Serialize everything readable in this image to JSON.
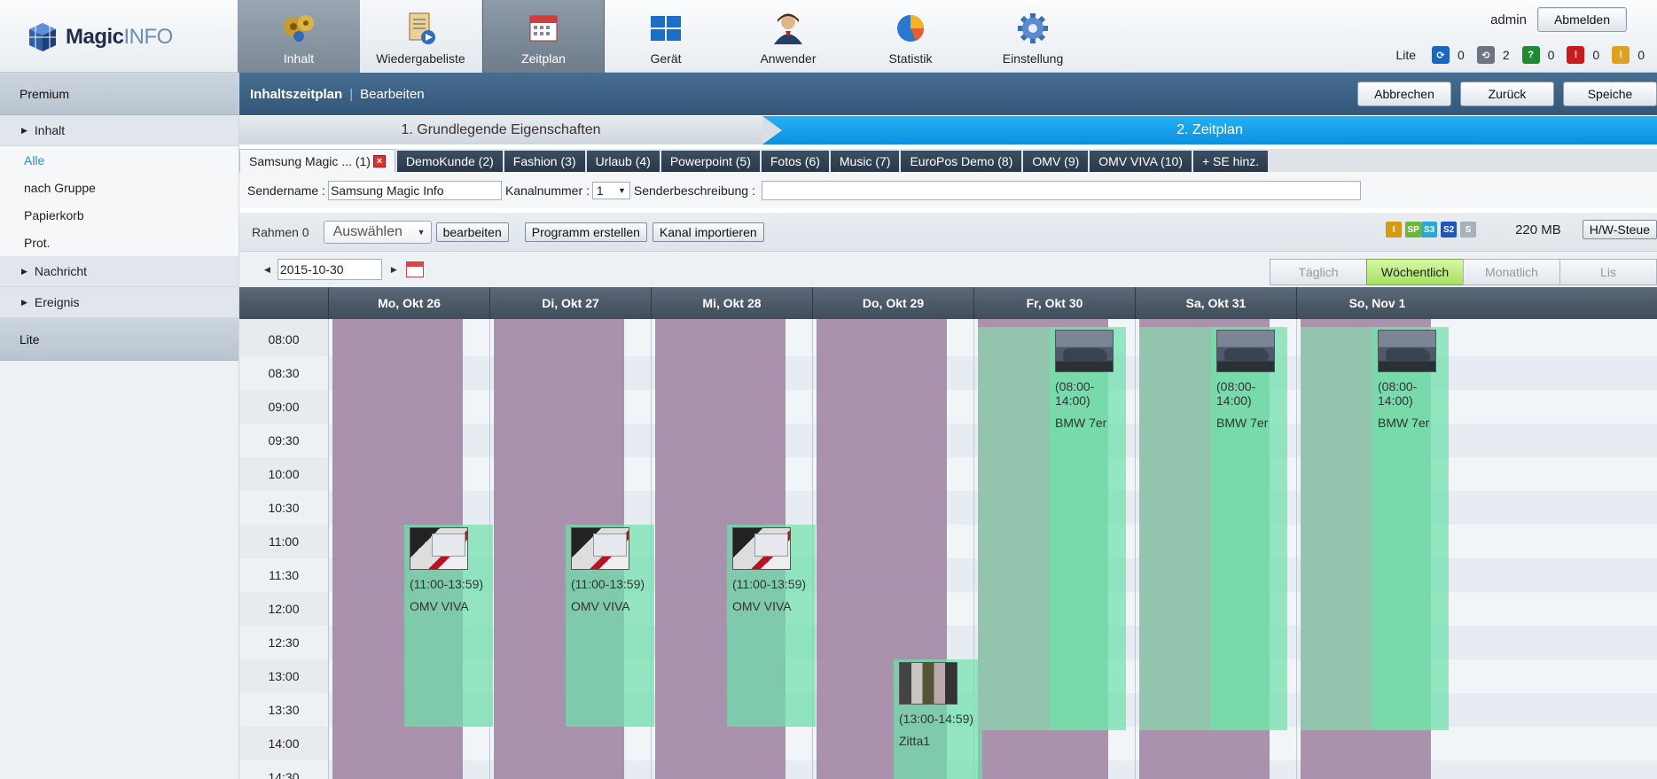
{
  "app": {
    "logo_bold": "Magic",
    "logo_light": "INFO"
  },
  "nav": [
    {
      "label": "Inhalt",
      "icon": "film-reel-icon"
    },
    {
      "label": "Wiedergabeliste",
      "icon": "playlist-icon"
    },
    {
      "label": "Zeitplan",
      "icon": "calendar-icon"
    },
    {
      "label": "Gerät",
      "icon": "device-icon"
    },
    {
      "label": "Anwender",
      "icon": "user-icon"
    },
    {
      "label": "Statistik",
      "icon": "pie-chart-icon"
    },
    {
      "label": "Einstellung",
      "icon": "gear-icon"
    }
  ],
  "user": {
    "name": "admin",
    "logout_label": "Abmelden"
  },
  "status": {
    "label": "Lite",
    "items": [
      {
        "icon": "connected-icon",
        "color": "#1a66c4",
        "count": "0"
      },
      {
        "icon": "disconnected-icon",
        "color": "#6c7580",
        "count": "2"
      },
      {
        "icon": "question-icon",
        "color": "#1f8a2f",
        "count": "0"
      },
      {
        "icon": "error-icon",
        "color": "#c81c1c",
        "count": "0"
      },
      {
        "icon": "warning-icon",
        "color": "#e0a020",
        "count": "0"
      }
    ]
  },
  "sidebar": {
    "premium": "Premium",
    "groups": [
      {
        "label": "Inhalt",
        "items": [
          "Alle",
          "nach Gruppe",
          "Papierkorb",
          "Prot."
        ]
      },
      {
        "label": "Nachricht",
        "items": []
      },
      {
        "label": "Ereignis",
        "items": []
      }
    ],
    "lite": "Lite"
  },
  "header": {
    "title": "Inhaltszeitplan",
    "subtitle": "Bearbeiten",
    "actions": [
      "Abbrechen",
      "Zurück",
      "Speiche"
    ]
  },
  "steps": {
    "step1": "1. Grundlegende Eigenschaften",
    "step2": "2. Zeitplan"
  },
  "channels": [
    "Samsung Magic ... (1)",
    "DemoKunde (2)",
    "Fashion (3)",
    "Urlaub (4)",
    "Powerpoint (5)",
    "Fotos (6)",
    "Music (7)",
    "EuroPos Demo (8)",
    "OMV (9)",
    "OMV VIVA (10)",
    "+ SE hinz."
  ],
  "channel_form": {
    "sendername_label": "Sendername :",
    "sendername_value": "Samsung Magic Info",
    "kanalnummer_label": "Kanalnummer :",
    "kanalnummer_value": "1",
    "beschreibung_label": "Senderbeschreibung :",
    "beschreibung_value": ""
  },
  "toolbar": {
    "frame_label": "Rahmen 0",
    "select_label": "Auswählen",
    "edit_label": "bearbeiten",
    "create_program_label": "Programm erstellen",
    "import_channel_label": "Kanal importieren",
    "badges": [
      {
        "text": "I",
        "color": "#d79a12"
      },
      {
        "text": "SP",
        "color": "#6cb93a"
      },
      {
        "text": "S3",
        "color": "#2aa7d8"
      },
      {
        "text": "S2",
        "color": "#2255c0"
      },
      {
        "text": "S",
        "color": "#a9b0b8"
      }
    ],
    "memory": "220 MB",
    "hw_label": "H/W-Steue"
  },
  "datebar": {
    "date": "2015-10-30",
    "views": [
      "Täglich",
      "Wöchentlich",
      "Monatlich",
      "Lis"
    ]
  },
  "schedule": {
    "days": [
      "Mo, Okt 26",
      "Di, Okt 27",
      "Mi, Okt 28",
      "Do, Okt 29",
      "Fr, Okt 30",
      "Sa, Okt 31",
      "So, Nov 1"
    ],
    "times": [
      "08:00",
      "08:30",
      "09:00",
      "09:30",
      "10:00",
      "10:30",
      "11:00",
      "11:30",
      "12:00",
      "12:30",
      "13:00",
      "13:30",
      "14:00",
      "14:30"
    ],
    "events": [
      {
        "day": 0,
        "time": "(11:00-13:59)",
        "title": "OMV VIVA",
        "thumb": "omv"
      },
      {
        "day": 1,
        "time": "(11:00-13:59)",
        "title": "OMV VIVA",
        "thumb": "omv"
      },
      {
        "day": 2,
        "time": "(11:00-13:59)",
        "title": "OMV VIVA",
        "thumb": "omv"
      },
      {
        "day": 3,
        "time": "(13:00-14:59)",
        "title": "Zitta1",
        "thumb": "zitta"
      },
      {
        "day": 4,
        "time": "(08:00-14:00)",
        "title": "BMW 7er",
        "thumb": "car"
      },
      {
        "day": 5,
        "time": "(08:00-14:00)",
        "title": "BMW 7er",
        "thumb": "car"
      },
      {
        "day": 6,
        "time": "(08:00-14:00)",
        "title": "BMW 7er",
        "thumb": "car"
      }
    ]
  }
}
